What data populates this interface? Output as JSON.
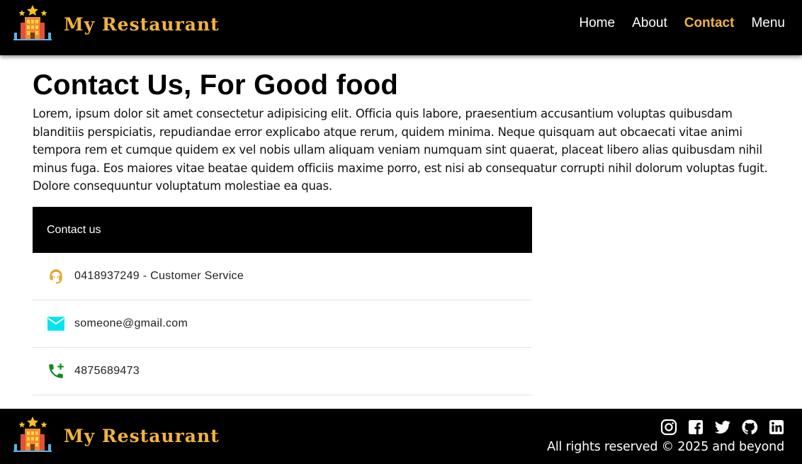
{
  "header": {
    "brand_name": "My Restaurant",
    "nav": [
      {
        "label": "Home",
        "active": false
      },
      {
        "label": "About",
        "active": false
      },
      {
        "label": "Contact",
        "active": true
      },
      {
        "label": "Menu",
        "active": false
      }
    ]
  },
  "main": {
    "title": "Contact Us, For Good food",
    "intro": "Lorem, ipsum dolor sit amet consectetur adipisicing elit. Officia quis labore, praesentium accusantium voluptas quibusdam blanditiis perspiciatis, repudiandae error explicabo atque rerum, quidem minima. Neque quisquam aut obcaecati vitae animi tempora rem et cumque quidem ex vel nobis ullam aliquam veniam numquam sint quaerat, placeat libero alias quibusdam nihil minus fuga. Eos maiores vitae beatae quidem officiis maxime porro, est nisi ab consequatur corrupti nihil dolorum voluptas fugit. Dolore consequuntur voluptatum molestiae ea quas.",
    "contact_card": {
      "heading": "Contact us",
      "items": [
        {
          "icon": "customer-service-icon",
          "text": "0418937249 - Customer Service"
        },
        {
          "icon": "email-icon",
          "text": "someone@gmail.com"
        },
        {
          "icon": "phone-add-icon",
          "text": "4875689473"
        }
      ]
    }
  },
  "footer": {
    "brand_name": "My Restaurant",
    "social_icons": [
      "instagram-icon",
      "facebook-icon",
      "twitter-icon",
      "github-icon",
      "linkedin-icon"
    ],
    "rights": "All rights reserved © 2025 and beyond"
  },
  "colors": {
    "background": "#000000",
    "accent": "#f2b33d",
    "email_icon": "#00e5ee",
    "phone_icon": "#138a1f",
    "service_icon": "#e0a82e"
  }
}
